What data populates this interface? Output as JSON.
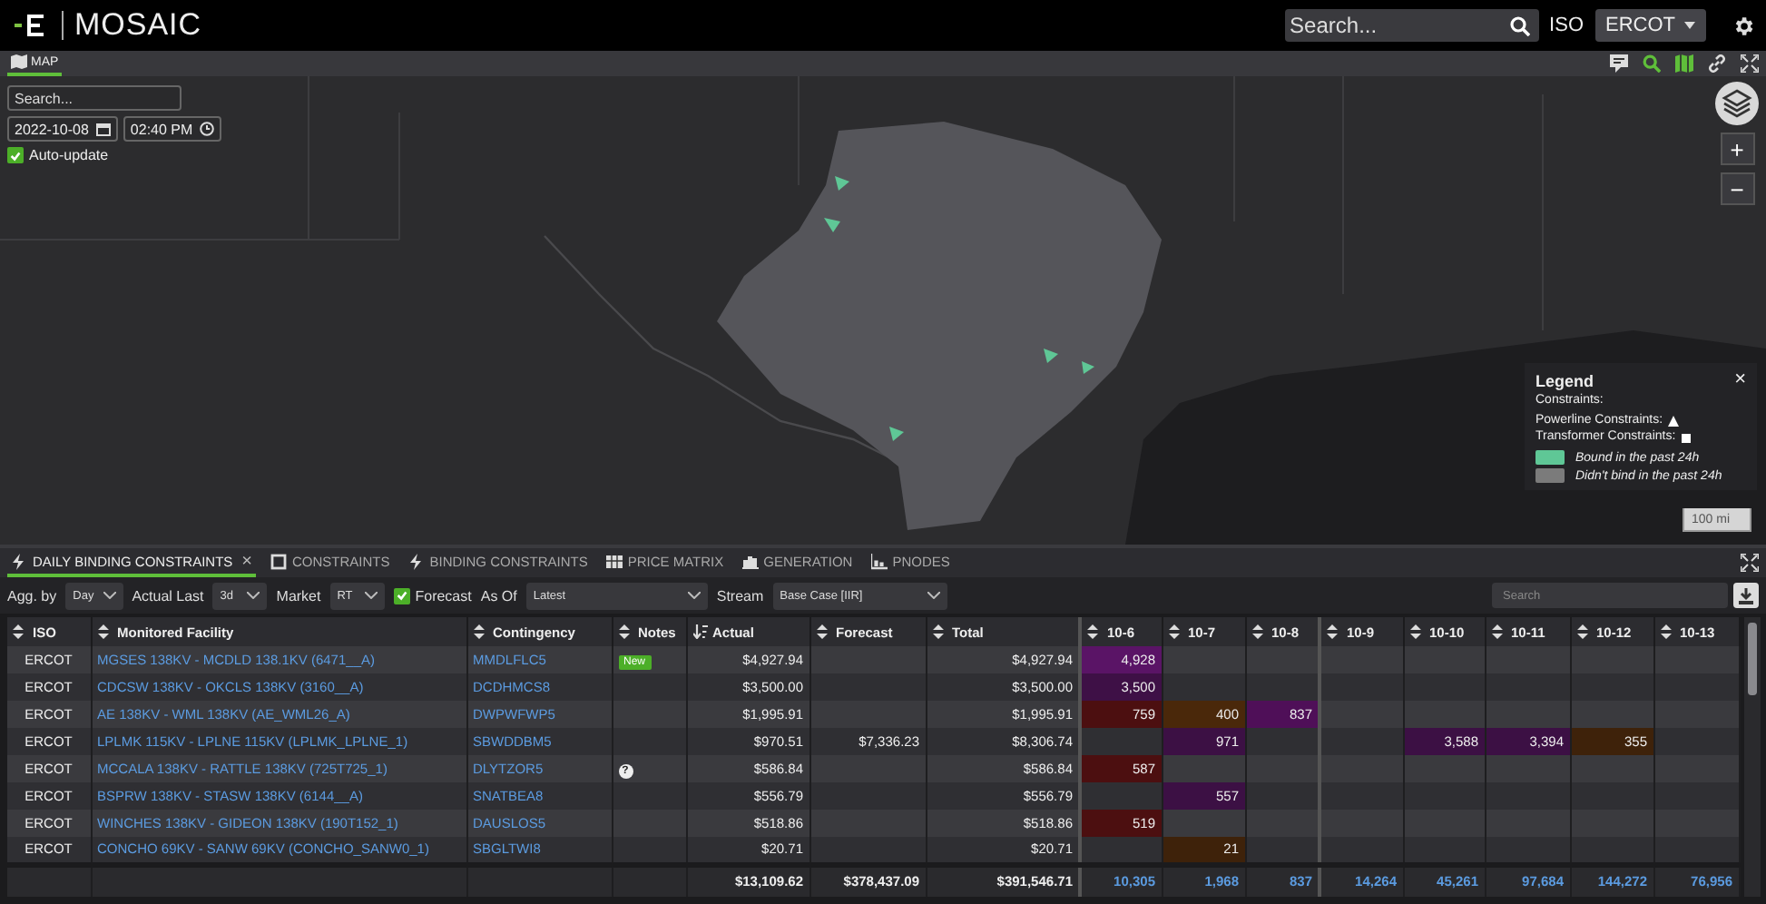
{
  "app": {
    "title": "MOSAIC",
    "search": {
      "placeholder": "Search..."
    },
    "iso_label": "ISO",
    "iso_value": "ERCOT"
  },
  "map_tab": {
    "label": "MAP",
    "selected": true
  },
  "map": {
    "search": {
      "placeholder": "Search..."
    },
    "date": "2022-10-08",
    "time": "02:40 PM",
    "auto_update": {
      "label": "Auto-update",
      "checked": true
    },
    "zoom_in": "+",
    "zoom_out": "−",
    "scale": "100 mi",
    "legend": {
      "title": "Legend",
      "close": "×",
      "heading": "Constraints:",
      "shapes": [
        {
          "label": "Powerline Constraints:",
          "kind": "triangle"
        },
        {
          "label": "Transformer Constraints:",
          "kind": "square"
        }
      ],
      "items": [
        {
          "label": "Bound in the past 24h",
          "color": "#5fc796"
        },
        {
          "label": "Didn't bind in the past 24h",
          "color": "#7b7b7b"
        }
      ]
    }
  },
  "panel_tabs": [
    {
      "label": "DAILY BINDING CONSTRAINTS",
      "selected": true,
      "close": "×"
    },
    {
      "label": "CONSTRAINTS",
      "selected": false
    },
    {
      "label": "BINDING CONSTRAINTS",
      "selected": false
    },
    {
      "label": "PRICE MATRIX",
      "selected": false
    },
    {
      "label": "GENERATION",
      "selected": false
    },
    {
      "label": "PNODES",
      "selected": false
    }
  ],
  "toolbar": {
    "controls": [
      {
        "kind": "label",
        "text": "Agg. by"
      },
      {
        "kind": "select",
        "value": "Day"
      },
      {
        "kind": "label",
        "text": "Actual Last"
      },
      {
        "kind": "select",
        "value": "3d"
      },
      {
        "kind": "label",
        "text": "Market"
      },
      {
        "kind": "select",
        "value": "RT"
      },
      {
        "kind": "checkbox",
        "label": "Forecast",
        "checked": true
      },
      {
        "kind": "label",
        "text": "As Of"
      },
      {
        "kind": "select",
        "value": "Latest"
      },
      {
        "kind": "label",
        "text": "Stream"
      },
      {
        "kind": "select",
        "value": "Base Case [IIR]"
      }
    ],
    "search": {
      "placeholder": "Search"
    }
  },
  "table": {
    "columns": [
      {
        "label": "ISO",
        "kind": "iso",
        "sorted": false
      },
      {
        "label": "Monitored Facility",
        "kind": "facility",
        "sorted": false
      },
      {
        "label": "Contingency",
        "kind": "contingency",
        "sorted": false
      },
      {
        "label": "Notes",
        "kind": "notes",
        "sorted": false
      },
      {
        "label": "Actual",
        "kind": "money",
        "sorted": true
      },
      {
        "label": "Forecast",
        "kind": "money",
        "sorted": false
      },
      {
        "label": "Total",
        "kind": "money",
        "sorted": false
      },
      {
        "label": "10-6",
        "kind": "day",
        "sorted": false
      },
      {
        "label": "10-7",
        "kind": "day",
        "sorted": false
      },
      {
        "label": "10-8",
        "kind": "day",
        "sorted": false
      },
      {
        "label": "10-9",
        "kind": "day",
        "sorted": false
      },
      {
        "label": "10-10",
        "kind": "day",
        "sorted": false
      },
      {
        "label": "10-11",
        "kind": "day",
        "sorted": false
      },
      {
        "label": "10-12",
        "kind": "day",
        "sorted": false
      },
      {
        "label": "10-13",
        "kind": "day",
        "sorted": false
      }
    ],
    "rows": [
      {
        "iso": "ERCOT",
        "facility": "MGSES 138KV - MCDLD 138.1KV (6471__A)",
        "contingency": "MMDLFLC5",
        "note": {
          "kind": "badge",
          "text": "New"
        },
        "actual": "$4,927.94",
        "total": "$4,927.94",
        "days": [
          {
            "kind": "value",
            "value": "4,928",
            "color": "#5a1466"
          },
          {
            "kind": "empty"
          },
          {
            "kind": "empty"
          },
          {
            "kind": "empty"
          },
          {
            "kind": "empty"
          },
          {
            "kind": "empty"
          },
          {
            "kind": "empty"
          },
          {
            "kind": "empty"
          }
        ]
      },
      {
        "iso": "ERCOT",
        "facility": "CDCSW 138KV - OKCLS 138KV (3160__A)",
        "contingency": "DCDHMCS8",
        "actual": "$3,500.00",
        "total": "$3,500.00",
        "days": [
          {
            "kind": "value",
            "value": "3,500",
            "color": "#3e1046"
          },
          {
            "kind": "empty"
          },
          {
            "kind": "empty"
          },
          {
            "kind": "empty"
          },
          {
            "kind": "empty"
          },
          {
            "kind": "empty"
          },
          {
            "kind": "empty"
          },
          {
            "kind": "empty"
          }
        ]
      },
      {
        "iso": "ERCOT",
        "facility": "AE 138KV - WML 138KV (AE_WML26_A)",
        "contingency": "DWPWFWP5",
        "actual": "$1,995.91",
        "total": "$1,995.91",
        "days": [
          {
            "kind": "value",
            "value": "759",
            "color": "#4c0f10"
          },
          {
            "kind": "value",
            "value": "400",
            "color": "#4a280a"
          },
          {
            "kind": "value",
            "value": "837",
            "color": "#4f0f58"
          },
          {
            "kind": "empty"
          },
          {
            "kind": "empty"
          },
          {
            "kind": "empty"
          },
          {
            "kind": "empty"
          },
          {
            "kind": "empty"
          }
        ]
      },
      {
        "iso": "ERCOT",
        "facility": "LPLMK 115KV - LPLNE 115KV (LPLMK_LPLNE_1)",
        "contingency": "SBWDDBM5",
        "actual": "$970.51",
        "forecast": "$7,336.23",
        "total": "$8,306.74",
        "days": [
          {
            "kind": "empty"
          },
          {
            "kind": "value",
            "value": "971",
            "color": "#3c1044"
          },
          {
            "kind": "empty"
          },
          {
            "kind": "empty"
          },
          {
            "kind": "value",
            "value": "3,588",
            "color": "#3c1044"
          },
          {
            "kind": "value",
            "value": "3,394",
            "color": "#3c1044"
          },
          {
            "kind": "value",
            "value": "355",
            "color": "#3e220a"
          },
          {
            "kind": "empty"
          }
        ]
      },
      {
        "iso": "ERCOT",
        "facility": "MCCALA 138KV - RATTLE 138KV (725T725_1)",
        "contingency": "DLYTZOR5",
        "note": {
          "kind": "icon",
          "text": "?"
        },
        "actual": "$586.84",
        "total": "$586.84",
        "days": [
          {
            "kind": "value",
            "value": "587",
            "color": "#4c0f10"
          },
          {
            "kind": "empty"
          },
          {
            "kind": "empty"
          },
          {
            "kind": "empty"
          },
          {
            "kind": "empty"
          },
          {
            "kind": "empty"
          },
          {
            "kind": "empty"
          },
          {
            "kind": "empty"
          }
        ]
      },
      {
        "iso": "ERCOT",
        "facility": "BSPRW 138KV - STASW 138KV (6144__A)",
        "contingency": "SNATBEA8",
        "actual": "$556.79",
        "total": "$556.79",
        "days": [
          {
            "kind": "empty"
          },
          {
            "kind": "value",
            "value": "557",
            "color": "#3c1044"
          },
          {
            "kind": "empty"
          },
          {
            "kind": "empty"
          },
          {
            "kind": "empty"
          },
          {
            "kind": "empty"
          },
          {
            "kind": "empty"
          },
          {
            "kind": "empty"
          }
        ]
      },
      {
        "iso": "ERCOT",
        "facility": "WINCHES 138KV - GIDEON 138KV (190T152_1)",
        "contingency": "DAUSLOS5",
        "actual": "$518.86",
        "total": "$518.86",
        "days": [
          {
            "kind": "value",
            "value": "519",
            "color": "#4c0f10"
          },
          {
            "kind": "empty"
          },
          {
            "kind": "empty"
          },
          {
            "kind": "empty"
          },
          {
            "kind": "empty"
          },
          {
            "kind": "empty"
          },
          {
            "kind": "empty"
          },
          {
            "kind": "empty"
          }
        ]
      },
      {
        "iso": "ERCOT",
        "facility": "CONCHO 69KV - SANW 69KV (CONCHO_SANW0_1)",
        "contingency": "SBGLTWI8",
        "actual": "$20.71",
        "total": "$20.71",
        "days": [
          {
            "kind": "empty"
          },
          {
            "kind": "value",
            "value": "21",
            "color": "#3e220a"
          },
          {
            "kind": "empty"
          },
          {
            "kind": "empty"
          },
          {
            "kind": "empty"
          },
          {
            "kind": "empty"
          },
          {
            "kind": "empty"
          },
          {
            "kind": "empty"
          }
        ]
      }
    ],
    "totals": {
      "actual": "$13,109.62",
      "forecast": "$378,437.09",
      "total": "$391,546.71",
      "days": [
        "10,305",
        "1,968",
        "837",
        "14,264",
        "45,261",
        "97,684",
        "144,272",
        "76,956"
      ]
    }
  }
}
